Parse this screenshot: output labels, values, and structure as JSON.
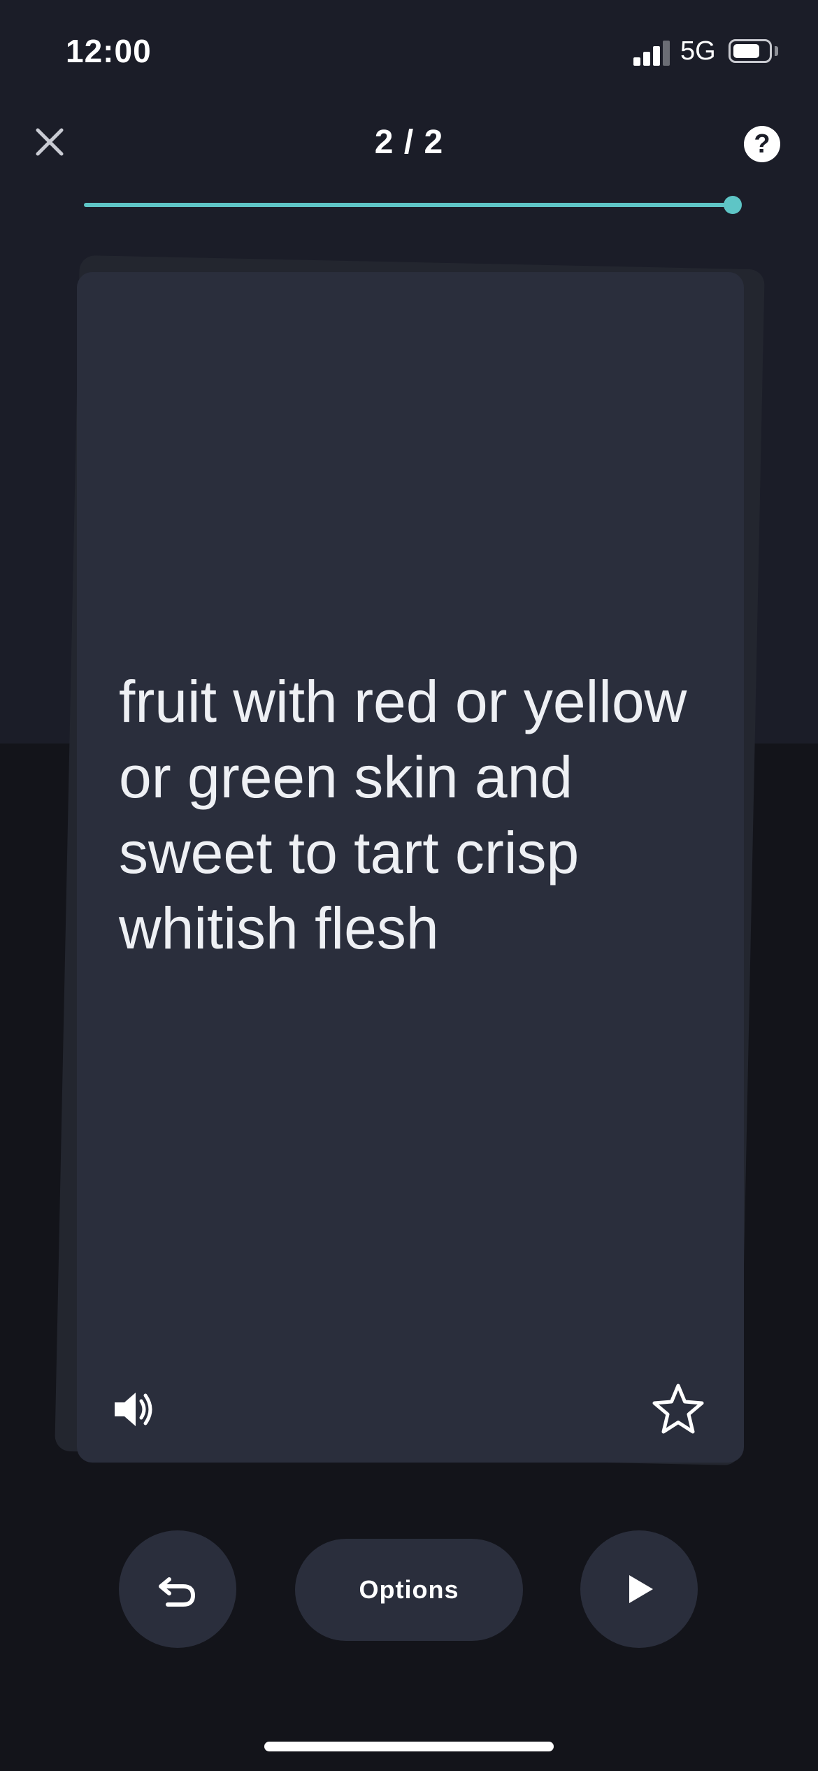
{
  "status_bar": {
    "time": "12:00",
    "network": "5G",
    "signal_bars_active": 3,
    "battery_level": 0.8
  },
  "header": {
    "counter": "2 / 2",
    "close_icon": "close-icon",
    "help_label": "?"
  },
  "progress": {
    "current": 2,
    "total": 2,
    "fraction": 1.0,
    "color": "#5ec5c6"
  },
  "card": {
    "text": "fruit with red or yellow or green skin and sweet to tart crisp whitish flesh",
    "audio_icon": "speaker-icon",
    "star_icon": "star-outline-icon"
  },
  "controls": {
    "undo_icon": "undo-icon",
    "options_label": "Options",
    "play_icon": "play-icon"
  },
  "colors": {
    "background_top": "#1b1d28",
    "background_bottom": "#13141a",
    "card": "#2a2e3c",
    "accent": "#5ec5c6"
  }
}
